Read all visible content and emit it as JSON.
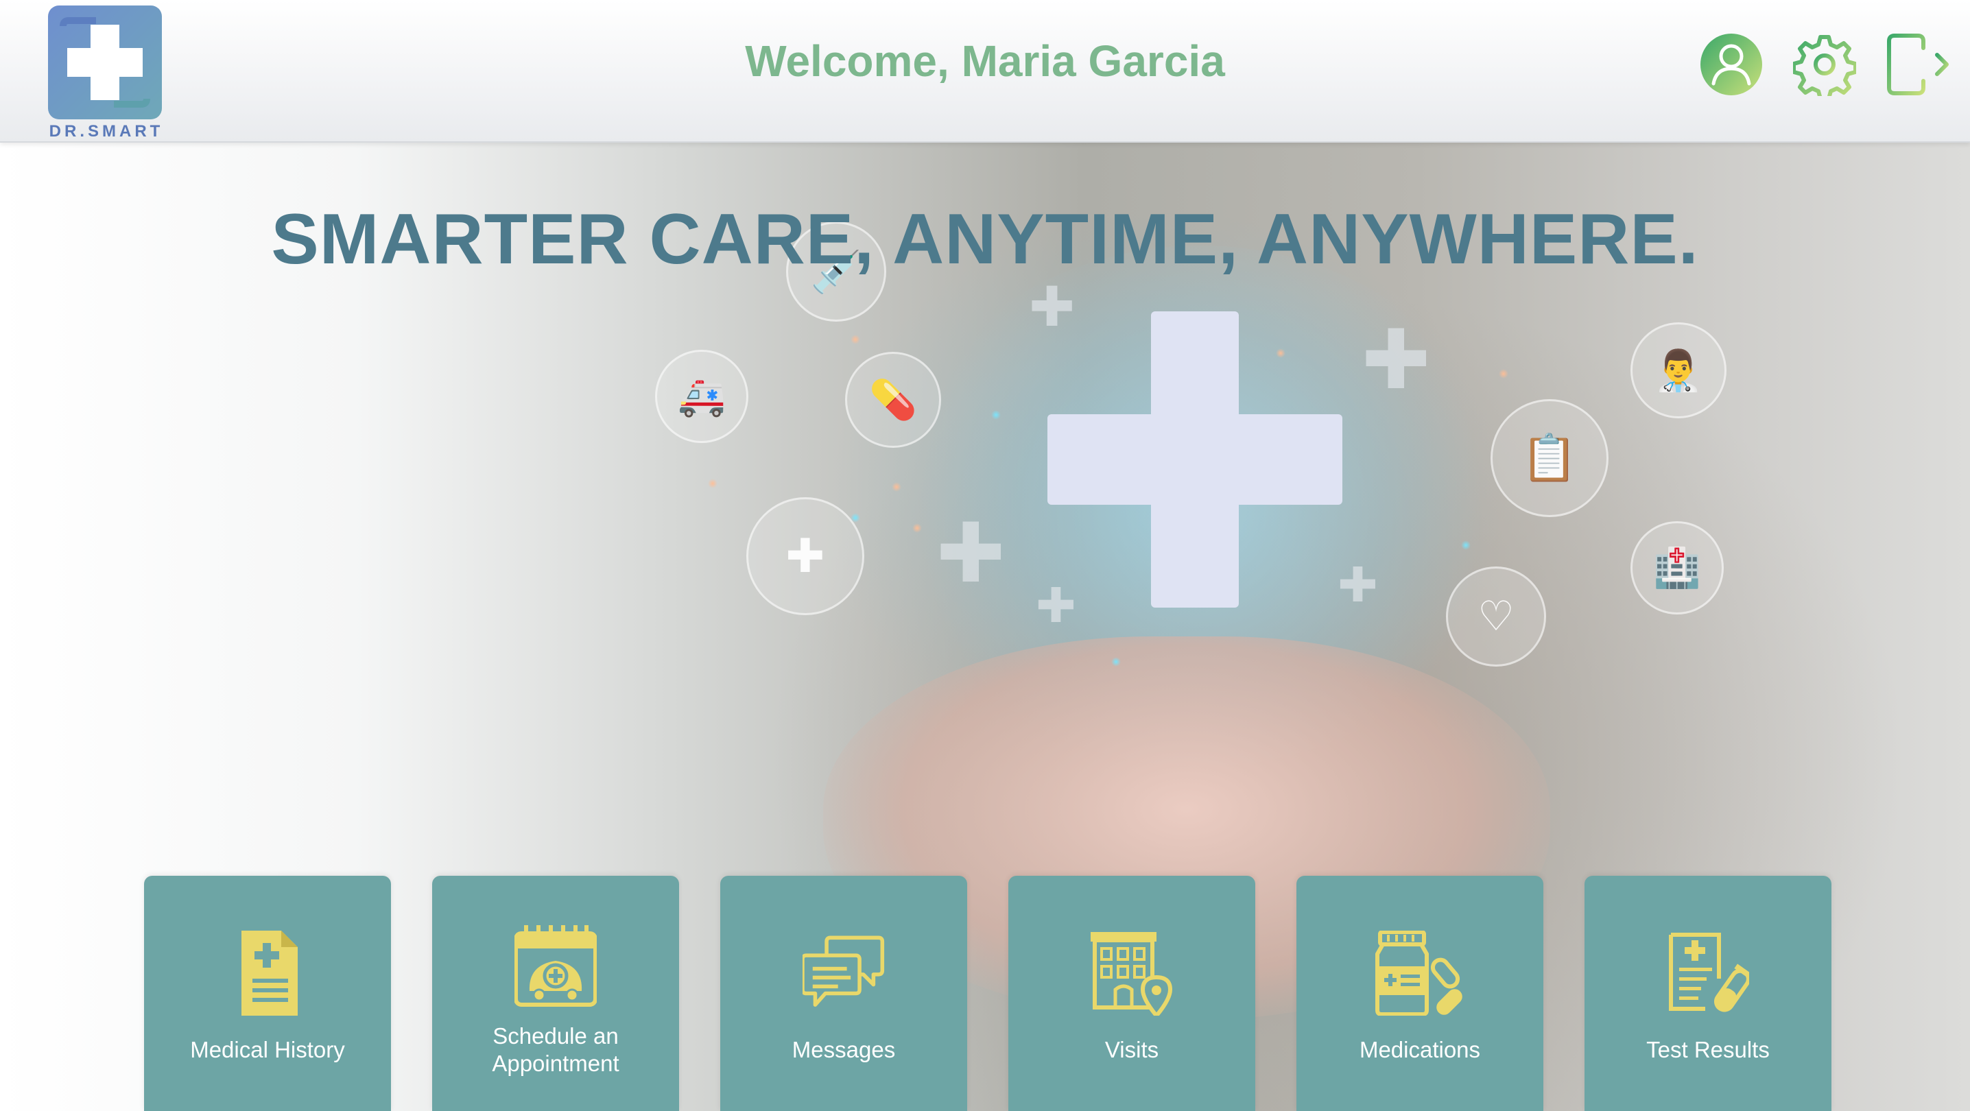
{
  "header": {
    "logo_text": "DR.SMART",
    "welcome": "Welcome, Maria Garcia",
    "profile_icon": "user-circle-icon",
    "settings_icon": "gear-icon",
    "logout_icon": "logout-icon"
  },
  "hero": {
    "tagline": "SMARTER CARE, ANYTIME, ANYWHERE."
  },
  "tiles": [
    {
      "label": "Medical History",
      "icon": "medical-document-icon"
    },
    {
      "label": "Schedule an Appointment",
      "icon": "calendar-ambulance-icon"
    },
    {
      "label": "Messages",
      "icon": "chat-bubbles-icon"
    },
    {
      "label": "Visits",
      "icon": "hospital-location-icon"
    },
    {
      "label": "Medications",
      "icon": "pill-bottle-icon"
    },
    {
      "label": "Test Results",
      "icon": "lab-report-icon"
    }
  ],
  "colors": {
    "accent_green": "#7db78e",
    "tagline_blue": "#4d7a8c",
    "tile_teal": "#6da5a5",
    "tile_icon_yellow": "#e9d86a",
    "logo_blue": "#5a79b8"
  }
}
